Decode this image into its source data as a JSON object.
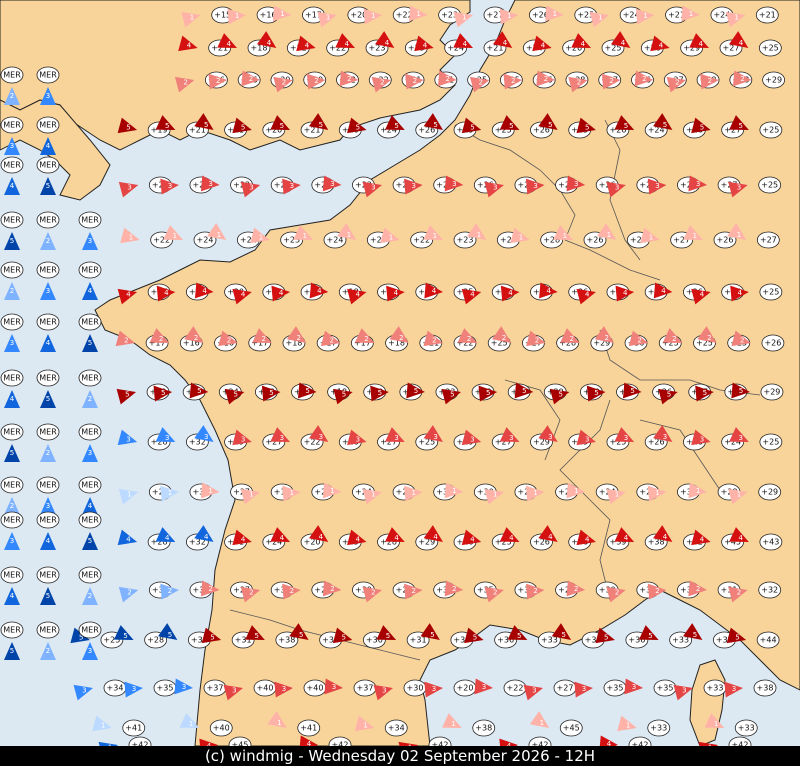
{
  "footer": {
    "text": "(c) windmig - Wednesday 02 September 2026 - 12H"
  },
  "colors": {
    "sea": "#dce8f2",
    "land": "#f8d49a",
    "border": "#555555",
    "coast": "#222222",
    "wind": {
      "1": "#bcd9ff",
      "2": "#7fb2ff",
      "3": "#3388ff",
      "4": "#1166dd",
      "5": "#0044aa"
    },
    "onshore": {
      "1": "#ffb3a8",
      "2": "#f0807a",
      "3": "#e54444",
      "4": "#d41010",
      "5": "#a80000"
    }
  },
  "sea_label": "MER",
  "temperature_rows": [
    [
      "+15",
      "+16",
      "+17",
      "+20",
      "+22",
      "+23",
      "+27",
      "+26",
      "+25",
      "+24",
      "+21",
      "+24",
      "+21"
    ],
    [
      "+21",
      "+18",
      "+22",
      "+22",
      "+23",
      "+25",
      "+24",
      "+21",
      "+24",
      "+26",
      "+25",
      "+28",
      "+29",
      "+27",
      "+25"
    ],
    [
      "+16",
      "+16",
      "+20",
      "+20",
      "+22",
      "+22",
      "+21",
      "+21",
      "+25",
      "+25",
      "+26",
      "+28",
      "+27",
      "+26",
      "+27",
      "+28",
      "+28",
      "+29"
    ],
    [
      "+19",
      "+21",
      "+21",
      "+20",
      "+21",
      "+20",
      "+24",
      "+26",
      "+25",
      "+25",
      "+26",
      "+25",
      "+26",
      "+24",
      "+26",
      "+27",
      "+25"
    ],
    [
      "+22",
      "+20",
      "+23",
      "+24",
      "+25",
      "+23",
      "+25",
      "+25",
      "+26",
      "+26",
      "+25",
      "+26",
      "+26",
      "+25",
      "+27",
      "+25"
    ],
    [
      "+22",
      "+24",
      "+22",
      "+23",
      "+24",
      "+23",
      "+22",
      "+23",
      "+26",
      "+28",
      "+26",
      "+28",
      "+27",
      "+26",
      "+27"
    ],
    [
      "+17",
      "+16",
      "+20",
      "+16",
      "+17",
      "+18",
      "+19",
      "+23",
      "+25",
      "+24",
      "+26",
      "+26",
      "+29",
      "+28",
      "+26",
      "+24",
      "+25"
    ],
    [
      "+17",
      "+16",
      "+16",
      "+17",
      "+18",
      "+17",
      "+17",
      "+18",
      "+21",
      "+22",
      "+25",
      "+27",
      "+28",
      "+29",
      "+30",
      "+25",
      "+25",
      "+25",
      "+26"
    ],
    [
      "+19",
      "+25",
      "+24",
      "+23",
      "+24",
      "+18",
      "+20",
      "+24",
      "+23",
      "+28",
      "+29",
      "+29",
      "+30",
      "+29",
      "+26",
      "+27",
      "+26",
      "+29"
    ],
    [
      "+28",
      "+32",
      "+29",
      "+27",
      "+22",
      "+18",
      "+27",
      "+25",
      "+29",
      "+27",
      "+29",
      "+25",
      "+25",
      "+26",
      "+26",
      "+24",
      "+25"
    ],
    [
      "+29",
      "+32",
      "+27",
      "+19",
      "+20",
      "+24",
      "+27",
      "+33",
      "+30",
      "+29",
      "+26",
      "+24",
      "+28",
      "+31",
      "+28",
      "+29"
    ],
    [
      "+28",
      "+32",
      "+31",
      "+24",
      "+20",
      "+25",
      "+28",
      "+29",
      "+28",
      "+25",
      "+26",
      "+36",
      "+39",
      "+38",
      "+42",
      "+45",
      "+43"
    ],
    [
      "+32",
      "+31",
      "+27",
      "+30",
      "+27",
      "+30",
      "+25",
      "+36",
      "+35",
      "+33",
      "+27",
      "+30",
      "+32",
      "+31",
      "+31",
      "+32"
    ],
    [
      "+25",
      "+28",
      "+31",
      "+31",
      "+38",
      "+32",
      "+30",
      "+31",
      "+37",
      "+36",
      "+33",
      "+30",
      "+36",
      "+33",
      "+32",
      "+44"
    ],
    [
      "+34",
      "+35",
      "+37",
      "+40",
      "+40",
      "+37",
      "+30",
      "+20",
      "+22",
      "+27",
      "+35",
      "+35",
      "+33",
      "+38"
    ],
    [
      "+41",
      "+40",
      "+41",
      "+34",
      "+38",
      "+45",
      "+33",
      "+33"
    ],
    [
      "+42",
      "+45",
      "+42",
      "+42",
      "+42",
      "+42",
      "+42"
    ]
  ]
}
